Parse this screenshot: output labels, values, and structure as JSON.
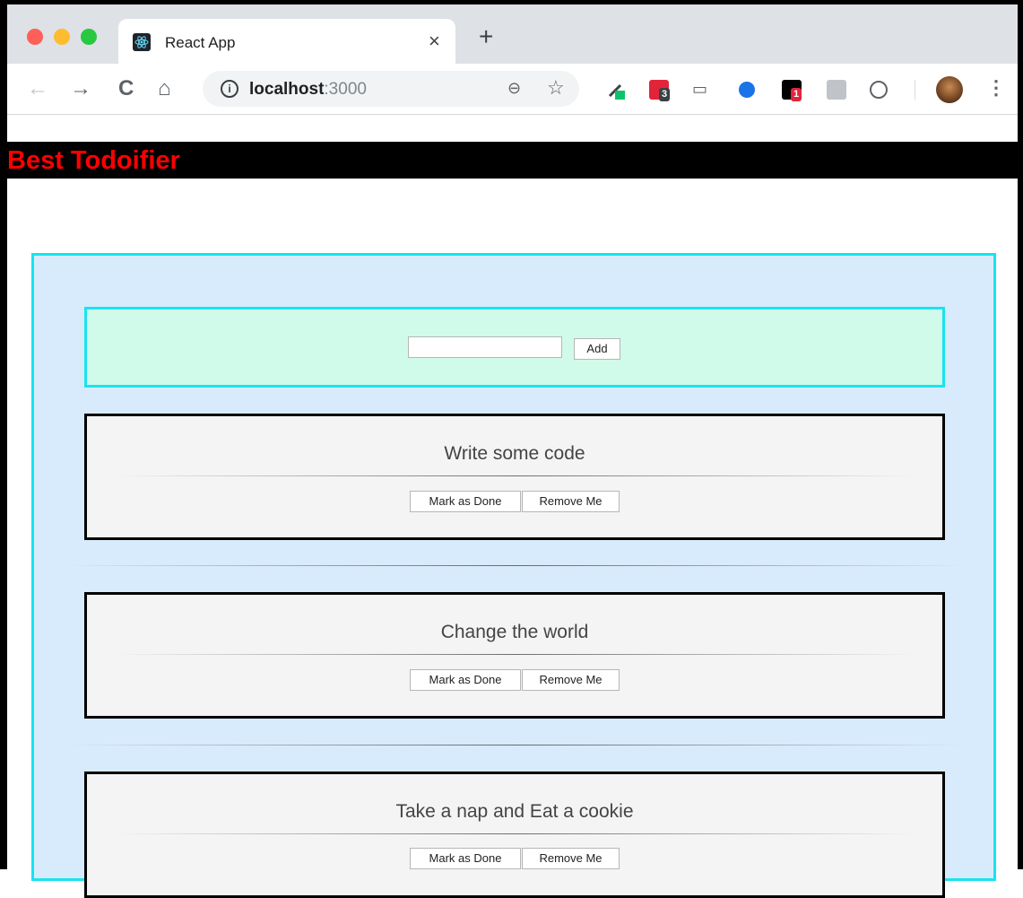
{
  "browser": {
    "tab_title": "React App",
    "tab_close": "×",
    "new_tab": "+",
    "url_host": "localhost",
    "url_port": ":3000",
    "info_symbol": "i",
    "extension_badges": [
      "3",
      "1"
    ]
  },
  "app": {
    "title": "Best Todoifier",
    "add_form": {
      "input_value": "",
      "add_label": "Add"
    },
    "todos": [
      {
        "text": "Write some code",
        "done_label": "Mark as Done",
        "remove_label": "Remove Me"
      },
      {
        "text": "Change the world",
        "done_label": "Mark as Done",
        "remove_label": "Remove Me"
      },
      {
        "text": "Take a nap and Eat a cookie",
        "done_label": "Mark as Done",
        "remove_label": "Remove Me"
      }
    ]
  },
  "colors": {
    "header_bg": "#000000",
    "title_color": "#ff0000",
    "container_bg": "#d8ebfc",
    "container_border": "#19e3ef",
    "form_bg": "#d0fbea",
    "card_bg": "#f4f4f4"
  }
}
